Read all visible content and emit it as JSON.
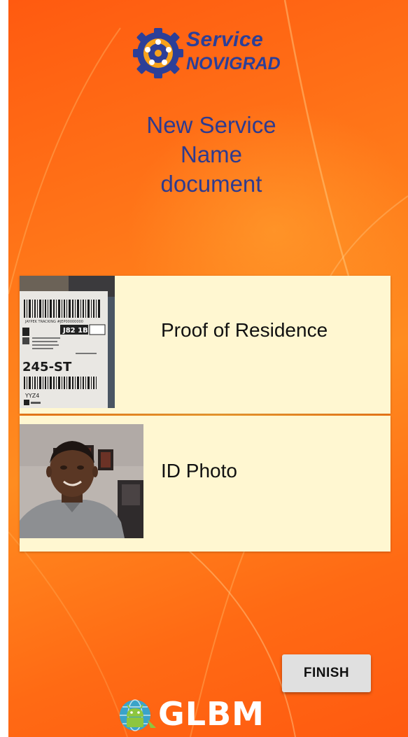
{
  "app": {
    "logo": {
      "line1": "Service",
      "line2": "NOVIGRAD",
      "icon": "gear-cluster-icon",
      "color": "#2c3f98"
    },
    "title_lines": [
      "New Service",
      "Name",
      "document"
    ]
  },
  "documents": [
    {
      "label": "Proof of Residence",
      "thumbnail": "shipping-label-photo",
      "thumbnail_text": [
        "JAYPEK  TRACKING #JEP00000000",
        "J82 1B7",
        "245-ST",
        "YYZ4"
      ]
    },
    {
      "label": "ID Photo",
      "thumbnail": "selfie-photo"
    }
  ],
  "actions": {
    "finish_label": "FINISH"
  },
  "footer": {
    "brand": "GLBM",
    "icon": "android-globe-icon"
  },
  "colors": {
    "background": "#ff7a1a",
    "card": "#fff7d1",
    "heading": "#2e3b8f",
    "button": "#e0e0e0"
  }
}
